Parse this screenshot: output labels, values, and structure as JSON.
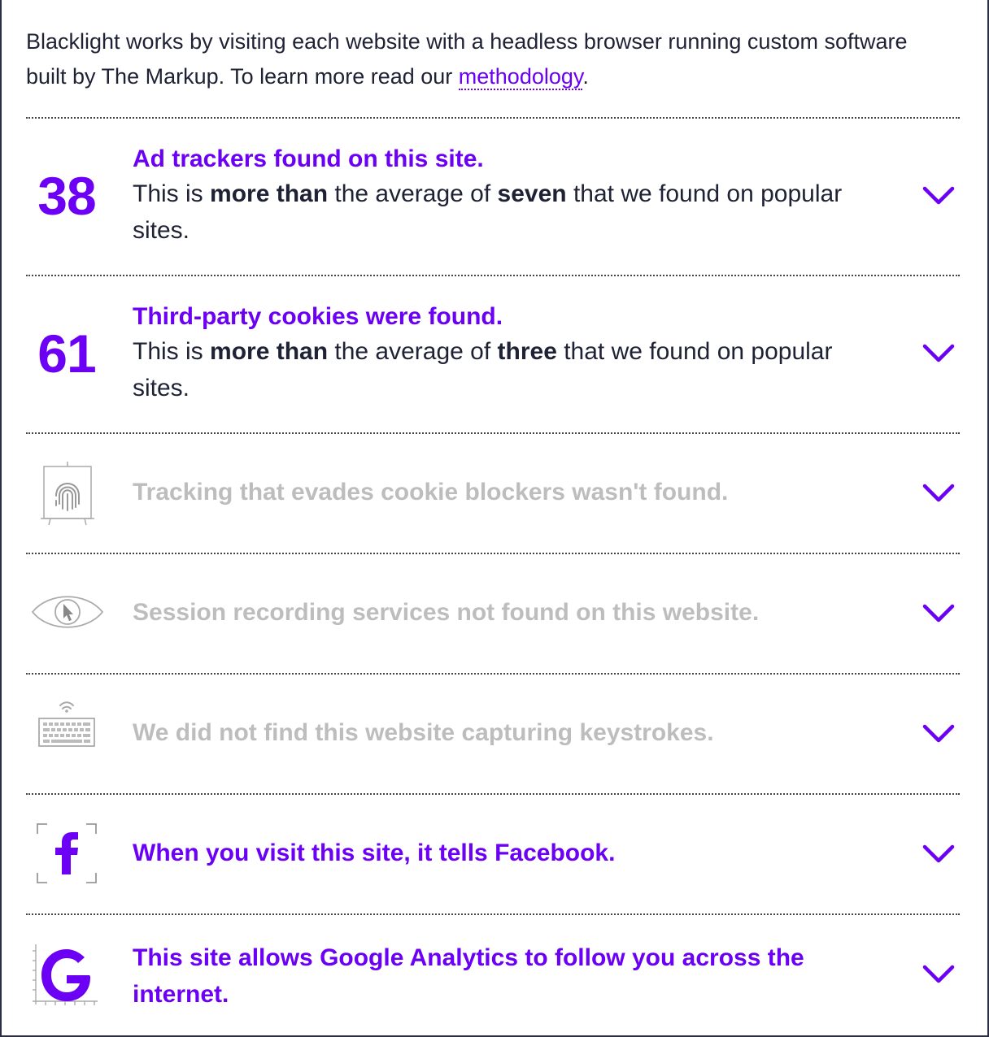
{
  "intro": {
    "text_before": "Blacklight works by visiting each website with a headless browser running custom software built by The Markup. To learn more read our ",
    "link_label": "methodology",
    "text_after": "."
  },
  "findings": [
    {
      "count": "38",
      "title": "Ad trackers found on this site.",
      "desc": {
        "pre": "This is ",
        "bold1": "more than",
        "mid": " the average of ",
        "bold2": "seven",
        "post": " that we found on popular sites."
      }
    },
    {
      "count": "61",
      "title": "Third-party cookies were found.",
      "desc": {
        "pre": "This is ",
        "bold1": "more than",
        "mid": " the average of ",
        "bold2": "three",
        "post": " that we found on popular sites."
      }
    },
    {
      "icon": "fingerprint-icon",
      "title": "Tracking that evades cookie blockers wasn't found."
    },
    {
      "icon": "eye-cursor-icon",
      "title": "Session recording services not found on this website."
    },
    {
      "icon": "keyboard-icon",
      "title": "We did not find this website capturing keystrokes."
    },
    {
      "icon": "facebook-icon",
      "title": "When you visit this site, it tells Facebook."
    },
    {
      "icon": "google-icon",
      "title": "This site allows Google Analytics to follow you across the internet."
    }
  ],
  "colors": {
    "accent": "#6b00f5",
    "muted": "#bdbdbd",
    "text": "#1f2235"
  }
}
